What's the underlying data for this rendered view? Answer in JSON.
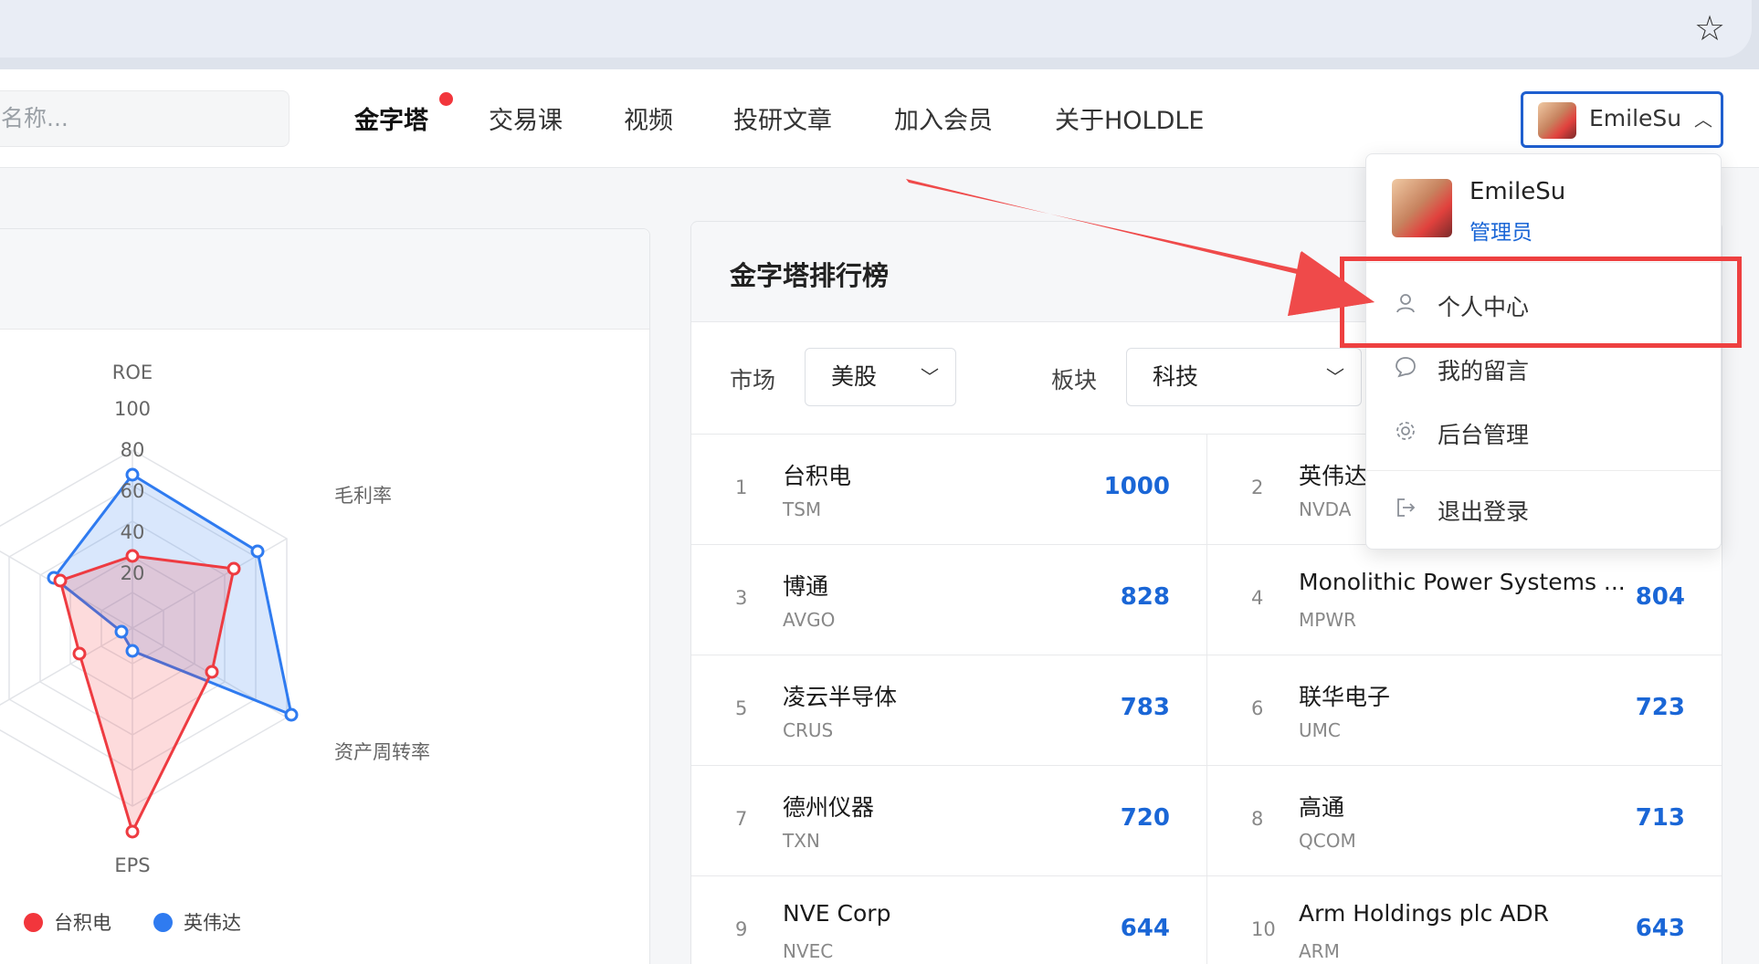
{
  "nav": {
    "search_placeholder": "名称...",
    "items": [
      "金字塔",
      "交易课",
      "视频",
      "投研文章",
      "加入会员",
      "关于HOLDLE"
    ],
    "username": "EmileSu",
    "chevron": "^"
  },
  "radar": {
    "axes": [
      "ROE",
      "毛利率",
      "资产周转率",
      "EPS"
    ],
    "ticks": [
      "100",
      "80",
      "60",
      "40",
      "20"
    ],
    "legend": [
      {
        "name": "台积电",
        "color": "#f2363c"
      },
      {
        "name": "英伟达",
        "color": "#2f7bf0"
      }
    ]
  },
  "ranking": {
    "title": "金字塔排行榜",
    "market_label": "市场",
    "market_value": "美股",
    "sector_label": "板块",
    "sector_value": "科技",
    "rows": [
      {
        "no": "1",
        "name": "台积电",
        "ticker": "TSM",
        "score": "1000"
      },
      {
        "no": "2",
        "name": "英伟达",
        "ticker": "NVDA",
        "score": ""
      },
      {
        "no": "3",
        "name": "博通",
        "ticker": "AVGO",
        "score": "828"
      },
      {
        "no": "4",
        "name": "Monolithic Power Systems ...",
        "ticker": "MPWR",
        "score": "804"
      },
      {
        "no": "5",
        "name": "凌云半导体",
        "ticker": "CRUS",
        "score": "783"
      },
      {
        "no": "6",
        "name": "联华电子",
        "ticker": "UMC",
        "score": "723"
      },
      {
        "no": "7",
        "name": "德州仪器",
        "ticker": "TXN",
        "score": "720"
      },
      {
        "no": "8",
        "name": "高通",
        "ticker": "QCOM",
        "score": "713"
      },
      {
        "no": "9",
        "name": "NVE Corp",
        "ticker": "NVEC",
        "score": "644"
      },
      {
        "no": "10",
        "name": "Arm Holdings plc ADR",
        "ticker": "ARM",
        "score": "643"
      }
    ]
  },
  "dropdown": {
    "name": "EmileSu",
    "role": "管理员",
    "items": [
      {
        "label": "个人中心",
        "icon": "user-icon"
      },
      {
        "label": "我的留言",
        "icon": "message-icon"
      },
      {
        "label": "后台管理",
        "icon": "gear-icon"
      },
      {
        "label": "退出登录",
        "icon": "logout-icon"
      }
    ]
  },
  "colors": {
    "accent": "#1f5fcf",
    "score": "#1a66d6",
    "red": "#f2363c",
    "blue": "#2f7bf0"
  }
}
